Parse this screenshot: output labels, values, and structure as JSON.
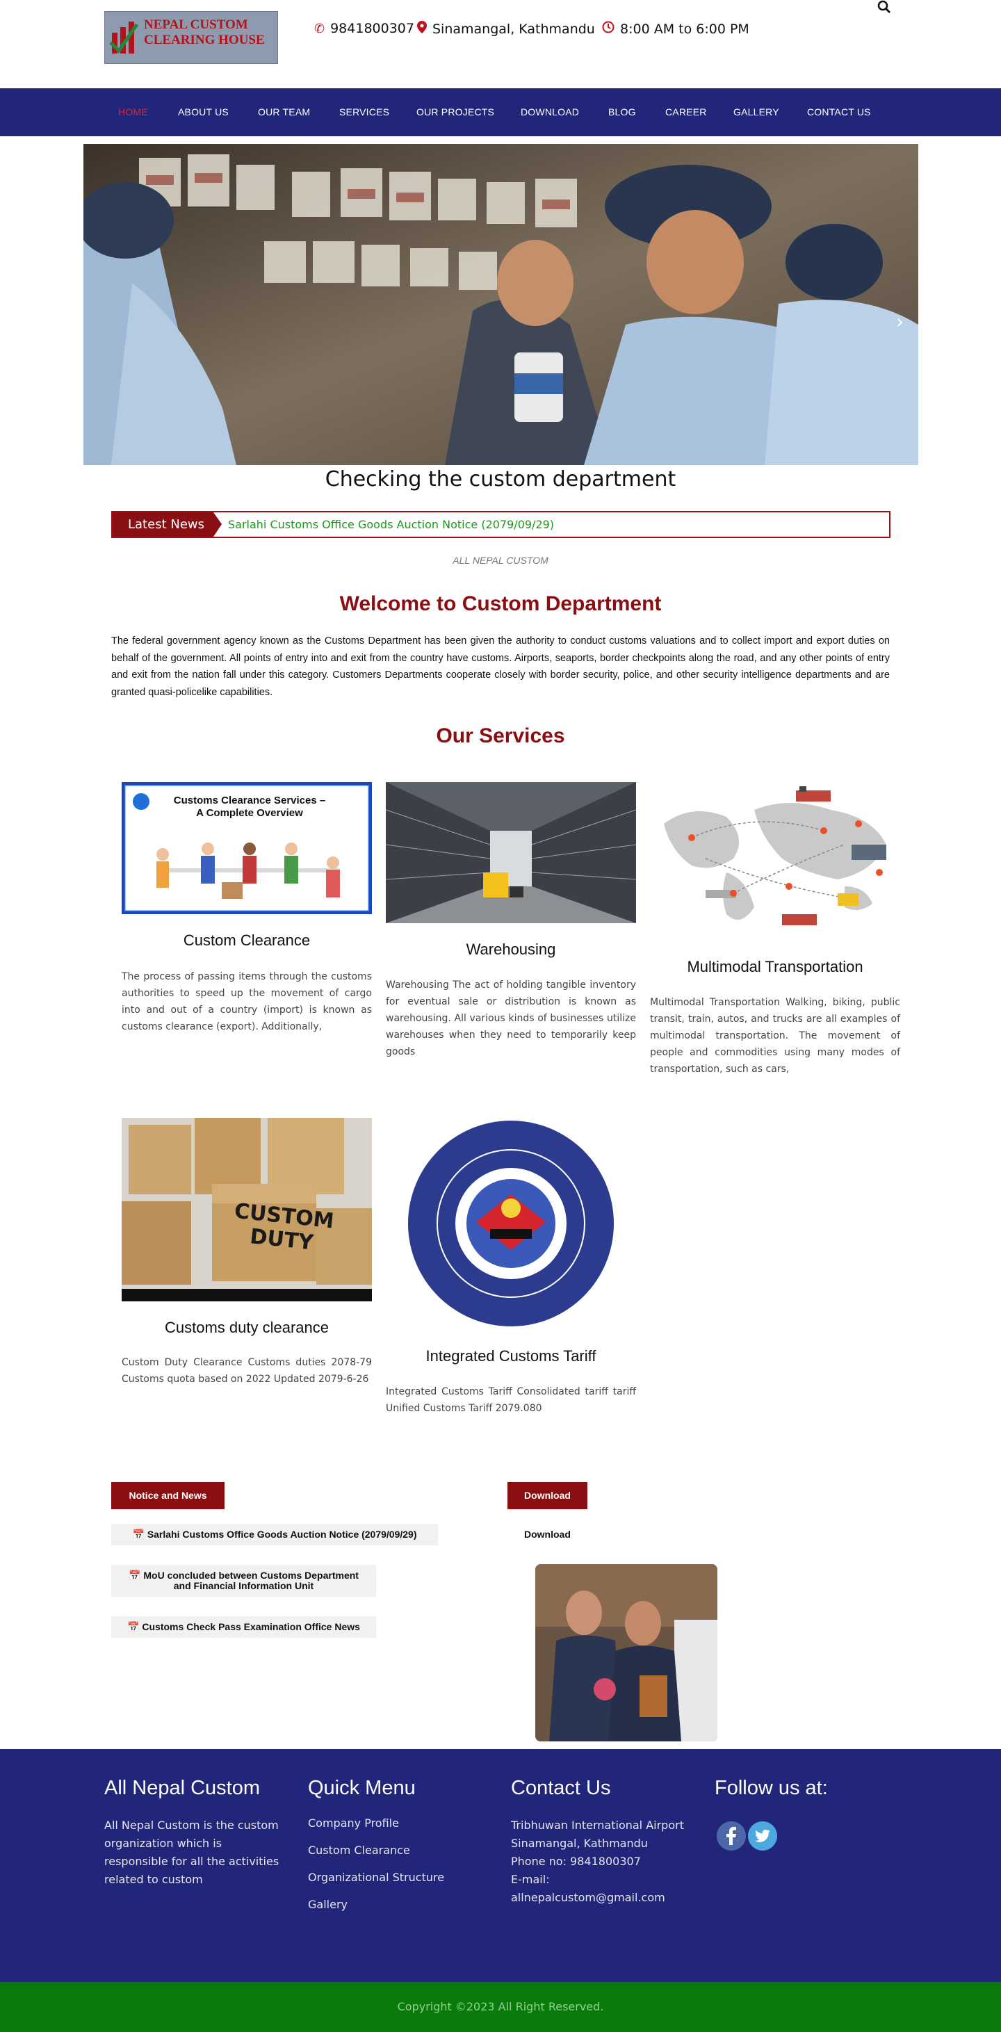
{
  "header": {
    "logo_text_line1": "NEPAL CUSTOM",
    "logo_text_line2": "CLEARING HOUSE",
    "phone": "9841800307",
    "location": "Sinamangal, Kathmandu",
    "hours": "8:00 AM to 6:00 PM",
    "search_icon": "search-icon"
  },
  "nav": {
    "items": [
      {
        "label": "HOME",
        "active": true
      },
      {
        "label": "ABOUT US"
      },
      {
        "label": "OUR TEAM"
      },
      {
        "label": "SERVICES"
      },
      {
        "label": "OUR PROJECTS"
      },
      {
        "label": "DOWNLOAD"
      },
      {
        "label": "BLOG"
      },
      {
        "label": "CAREER"
      },
      {
        "label": "GALLERY"
      },
      {
        "label": "CONTACT US"
      }
    ]
  },
  "slider": {
    "caption": "Checking the custom department",
    "next_icon": "chevron-right-icon"
  },
  "latest_news": {
    "label": "Latest News",
    "headline": "Sarlahi Customs Office Goods Auction Notice (2079/09/29)"
  },
  "intro": {
    "subtitle": "ALL NEPAL CUSTOM",
    "title": "Welcome to Custom Department",
    "text": "The federal government agency known as the Customs Department has been given the authority to conduct customs valuations and to collect import and export duties on behalf of the government. All points of entry into and exit from the country have customs. Airports, seaports, border checkpoints along the road, and any other points of entry and exit from the nation fall under this category. Customers Departments cooperate closely with border security, police, and other security intelligence departments and are granted quasi-policelike capabilities."
  },
  "services": {
    "title": "Our Services",
    "items": [
      {
        "title": "Custom Clearance",
        "desc": "The process of passing items through the customs authorities to speed up the movement of cargo into and out of a country (import) is known as customs clearance (export).  Additionally,",
        "img_title": "Customs Clearance Services –",
        "img_subtitle": "A Complete Overview"
      },
      {
        "title": "Warehousing",
        "desc": "Warehousing The act of holding tangible inventory for eventual sale or distribution is known as warehousing. All various kinds of businesses utilize warehouses when they need to temporarily keep goods"
      },
      {
        "title": "Multimodal Transportation",
        "desc": "Multimodal Transportation Walking, biking, public transit, train, autos, and trucks are all examples of multimodal transportation. The movement of people and commodities using many modes of transportation, such as cars,"
      },
      {
        "title": "Customs duty clearance",
        "desc": "Custom Duty Clearance Customs duties 2078-79 Customs quota based on 2022 Updated 2079-6-26",
        "img_text_line1": "CUSTOM",
        "img_text_line2": "DUTY"
      },
      {
        "title": "Integrated Customs Tariff",
        "desc": "Integrated Customs Tariff Consolidated tariff tariff Unified Customs Tariff 2079.080"
      }
    ]
  },
  "notices": {
    "tab_label": "Notice and News",
    "items": [
      "Sarlahi Customs Office Goods Auction Notice (2079/09/29)",
      "MoU concluded between Customs Department and Financial Information Unit",
      "Customs Check Pass Examination Office News"
    ],
    "item_icon": "calendar-icon"
  },
  "downloads": {
    "tab_label": "Download",
    "link_label": "Download"
  },
  "footer": {
    "about": {
      "heading": "All Nepal Custom",
      "text": "All Nepal Custom is the custom organization which is responsible for all the activities related to custom"
    },
    "quick_menu": {
      "heading": "Quick Menu",
      "links": [
        "Company Profile",
        "Custom Clearance",
        "Organizational Structure",
        "Gallery"
      ]
    },
    "contact": {
      "heading": "Contact Us",
      "line1": "Tribhuwan International Airport",
      "line2": "Sinamangal, Kathmandu",
      "line3": "Phone no: 9841800307",
      "line4": "E-mail: allnepalcustom@gmail.com"
    },
    "follow": {
      "heading": "Follow us at:",
      "icons": [
        "facebook-icon",
        "twitter-icon"
      ]
    },
    "copyright": "Copyright ©2023 All Right Reserved."
  },
  "colors": {
    "nav_bg": "#22267a",
    "accent_red": "#8b0d12",
    "news_green": "#1a9a1a",
    "copyright_bg": "#0a7a0a"
  }
}
